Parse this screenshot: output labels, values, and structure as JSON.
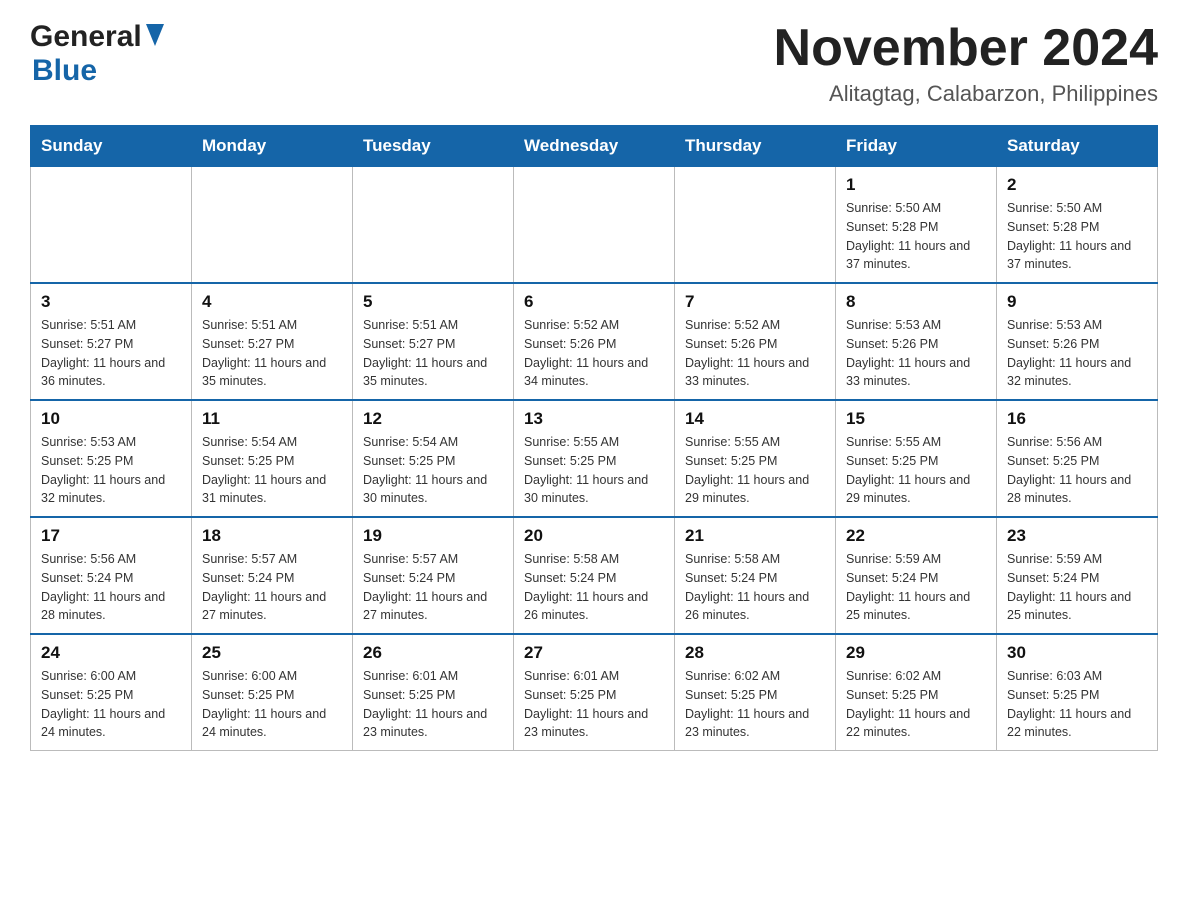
{
  "header": {
    "logo_general": "General",
    "logo_blue": "Blue",
    "month_title": "November 2024",
    "location": "Alitagtag, Calabarzon, Philippines"
  },
  "weekdays": [
    "Sunday",
    "Monday",
    "Tuesday",
    "Wednesday",
    "Thursday",
    "Friday",
    "Saturday"
  ],
  "weeks": [
    [
      {
        "day": "",
        "info": ""
      },
      {
        "day": "",
        "info": ""
      },
      {
        "day": "",
        "info": ""
      },
      {
        "day": "",
        "info": ""
      },
      {
        "day": "",
        "info": ""
      },
      {
        "day": "1",
        "info": "Sunrise: 5:50 AM\nSunset: 5:28 PM\nDaylight: 11 hours and 37 minutes."
      },
      {
        "day": "2",
        "info": "Sunrise: 5:50 AM\nSunset: 5:28 PM\nDaylight: 11 hours and 37 minutes."
      }
    ],
    [
      {
        "day": "3",
        "info": "Sunrise: 5:51 AM\nSunset: 5:27 PM\nDaylight: 11 hours and 36 minutes."
      },
      {
        "day": "4",
        "info": "Sunrise: 5:51 AM\nSunset: 5:27 PM\nDaylight: 11 hours and 35 minutes."
      },
      {
        "day": "5",
        "info": "Sunrise: 5:51 AM\nSunset: 5:27 PM\nDaylight: 11 hours and 35 minutes."
      },
      {
        "day": "6",
        "info": "Sunrise: 5:52 AM\nSunset: 5:26 PM\nDaylight: 11 hours and 34 minutes."
      },
      {
        "day": "7",
        "info": "Sunrise: 5:52 AM\nSunset: 5:26 PM\nDaylight: 11 hours and 33 minutes."
      },
      {
        "day": "8",
        "info": "Sunrise: 5:53 AM\nSunset: 5:26 PM\nDaylight: 11 hours and 33 minutes."
      },
      {
        "day": "9",
        "info": "Sunrise: 5:53 AM\nSunset: 5:26 PM\nDaylight: 11 hours and 32 minutes."
      }
    ],
    [
      {
        "day": "10",
        "info": "Sunrise: 5:53 AM\nSunset: 5:25 PM\nDaylight: 11 hours and 32 minutes."
      },
      {
        "day": "11",
        "info": "Sunrise: 5:54 AM\nSunset: 5:25 PM\nDaylight: 11 hours and 31 minutes."
      },
      {
        "day": "12",
        "info": "Sunrise: 5:54 AM\nSunset: 5:25 PM\nDaylight: 11 hours and 30 minutes."
      },
      {
        "day": "13",
        "info": "Sunrise: 5:55 AM\nSunset: 5:25 PM\nDaylight: 11 hours and 30 minutes."
      },
      {
        "day": "14",
        "info": "Sunrise: 5:55 AM\nSunset: 5:25 PM\nDaylight: 11 hours and 29 minutes."
      },
      {
        "day": "15",
        "info": "Sunrise: 5:55 AM\nSunset: 5:25 PM\nDaylight: 11 hours and 29 minutes."
      },
      {
        "day": "16",
        "info": "Sunrise: 5:56 AM\nSunset: 5:25 PM\nDaylight: 11 hours and 28 minutes."
      }
    ],
    [
      {
        "day": "17",
        "info": "Sunrise: 5:56 AM\nSunset: 5:24 PM\nDaylight: 11 hours and 28 minutes."
      },
      {
        "day": "18",
        "info": "Sunrise: 5:57 AM\nSunset: 5:24 PM\nDaylight: 11 hours and 27 minutes."
      },
      {
        "day": "19",
        "info": "Sunrise: 5:57 AM\nSunset: 5:24 PM\nDaylight: 11 hours and 27 minutes."
      },
      {
        "day": "20",
        "info": "Sunrise: 5:58 AM\nSunset: 5:24 PM\nDaylight: 11 hours and 26 minutes."
      },
      {
        "day": "21",
        "info": "Sunrise: 5:58 AM\nSunset: 5:24 PM\nDaylight: 11 hours and 26 minutes."
      },
      {
        "day": "22",
        "info": "Sunrise: 5:59 AM\nSunset: 5:24 PM\nDaylight: 11 hours and 25 minutes."
      },
      {
        "day": "23",
        "info": "Sunrise: 5:59 AM\nSunset: 5:24 PM\nDaylight: 11 hours and 25 minutes."
      }
    ],
    [
      {
        "day": "24",
        "info": "Sunrise: 6:00 AM\nSunset: 5:25 PM\nDaylight: 11 hours and 24 minutes."
      },
      {
        "day": "25",
        "info": "Sunrise: 6:00 AM\nSunset: 5:25 PM\nDaylight: 11 hours and 24 minutes."
      },
      {
        "day": "26",
        "info": "Sunrise: 6:01 AM\nSunset: 5:25 PM\nDaylight: 11 hours and 23 minutes."
      },
      {
        "day": "27",
        "info": "Sunrise: 6:01 AM\nSunset: 5:25 PM\nDaylight: 11 hours and 23 minutes."
      },
      {
        "day": "28",
        "info": "Sunrise: 6:02 AM\nSunset: 5:25 PM\nDaylight: 11 hours and 23 minutes."
      },
      {
        "day": "29",
        "info": "Sunrise: 6:02 AM\nSunset: 5:25 PM\nDaylight: 11 hours and 22 minutes."
      },
      {
        "day": "30",
        "info": "Sunrise: 6:03 AM\nSunset: 5:25 PM\nDaylight: 11 hours and 22 minutes."
      }
    ]
  ]
}
